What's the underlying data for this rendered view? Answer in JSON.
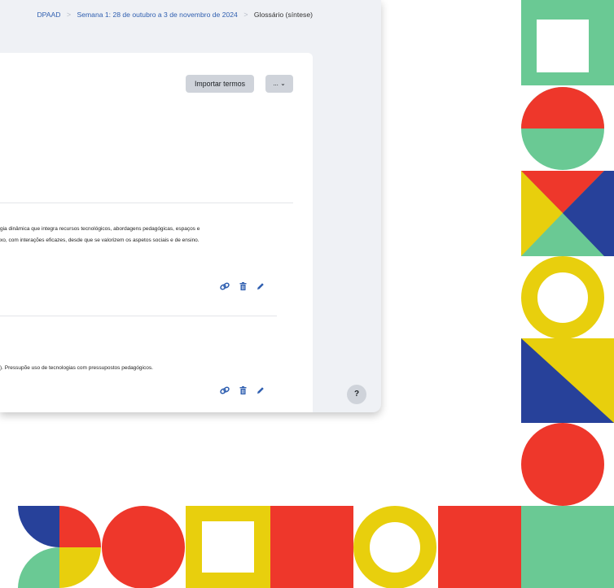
{
  "breadcrumb": {
    "course": "DPAAD",
    "section": "Semana 1: 28 de outubro a 3 de novembro de 2024",
    "current": "Glossário (síntese)"
  },
  "toolbar": {
    "import_label": "Importar termos",
    "more_label": "... ⌄"
  },
  "entries": [
    {
      "line1": "gia dinâmica que integra recursos tecnológicos, abordagens pedagógicas, espaços e",
      "line2": "xo, com interações eficazes, desde que se valorizem os aspetos sociais e de ensino."
    },
    {
      "line1": "). Pressupõe uso de tecnologias com pressupostos pedagógicos."
    }
  ],
  "help": {
    "label": "?"
  },
  "colors": {
    "accent_link": "#2f5fb0",
    "green": "#6ac994",
    "red": "#ee372b",
    "yellow": "#e8cf0d",
    "blue": "#27419a"
  }
}
